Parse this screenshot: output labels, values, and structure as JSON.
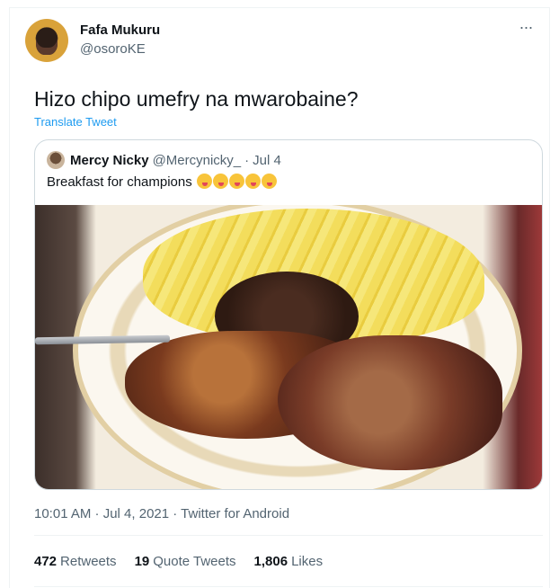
{
  "author": {
    "name": "Fafa Mukuru",
    "handle": "@osoroKE"
  },
  "more_icon": "more-horizontal-icon",
  "tweet": {
    "text": "Hizo chipo umefry na mwarobaine?",
    "translate": "Translate Tweet"
  },
  "quoted": {
    "name": "Mercy Nicky",
    "handle": "@Mercynicky_",
    "separator": "·",
    "date": "Jul 4",
    "text": "Breakfast for champions",
    "emoji_count": 5,
    "image_icon": "food-photo"
  },
  "meta": "10:01 AM · Jul 4, 2021 · Twitter for Android",
  "stats": [
    {
      "num": "472",
      "label": "Retweets"
    },
    {
      "num": "19",
      "label": "Quote Tweets"
    },
    {
      "num": "1,806",
      "label": "Likes"
    }
  ],
  "colors": {
    "link": "#1d9bf0",
    "muted": "#536471",
    "text": "#0f1419",
    "border": "#cfd9de"
  }
}
